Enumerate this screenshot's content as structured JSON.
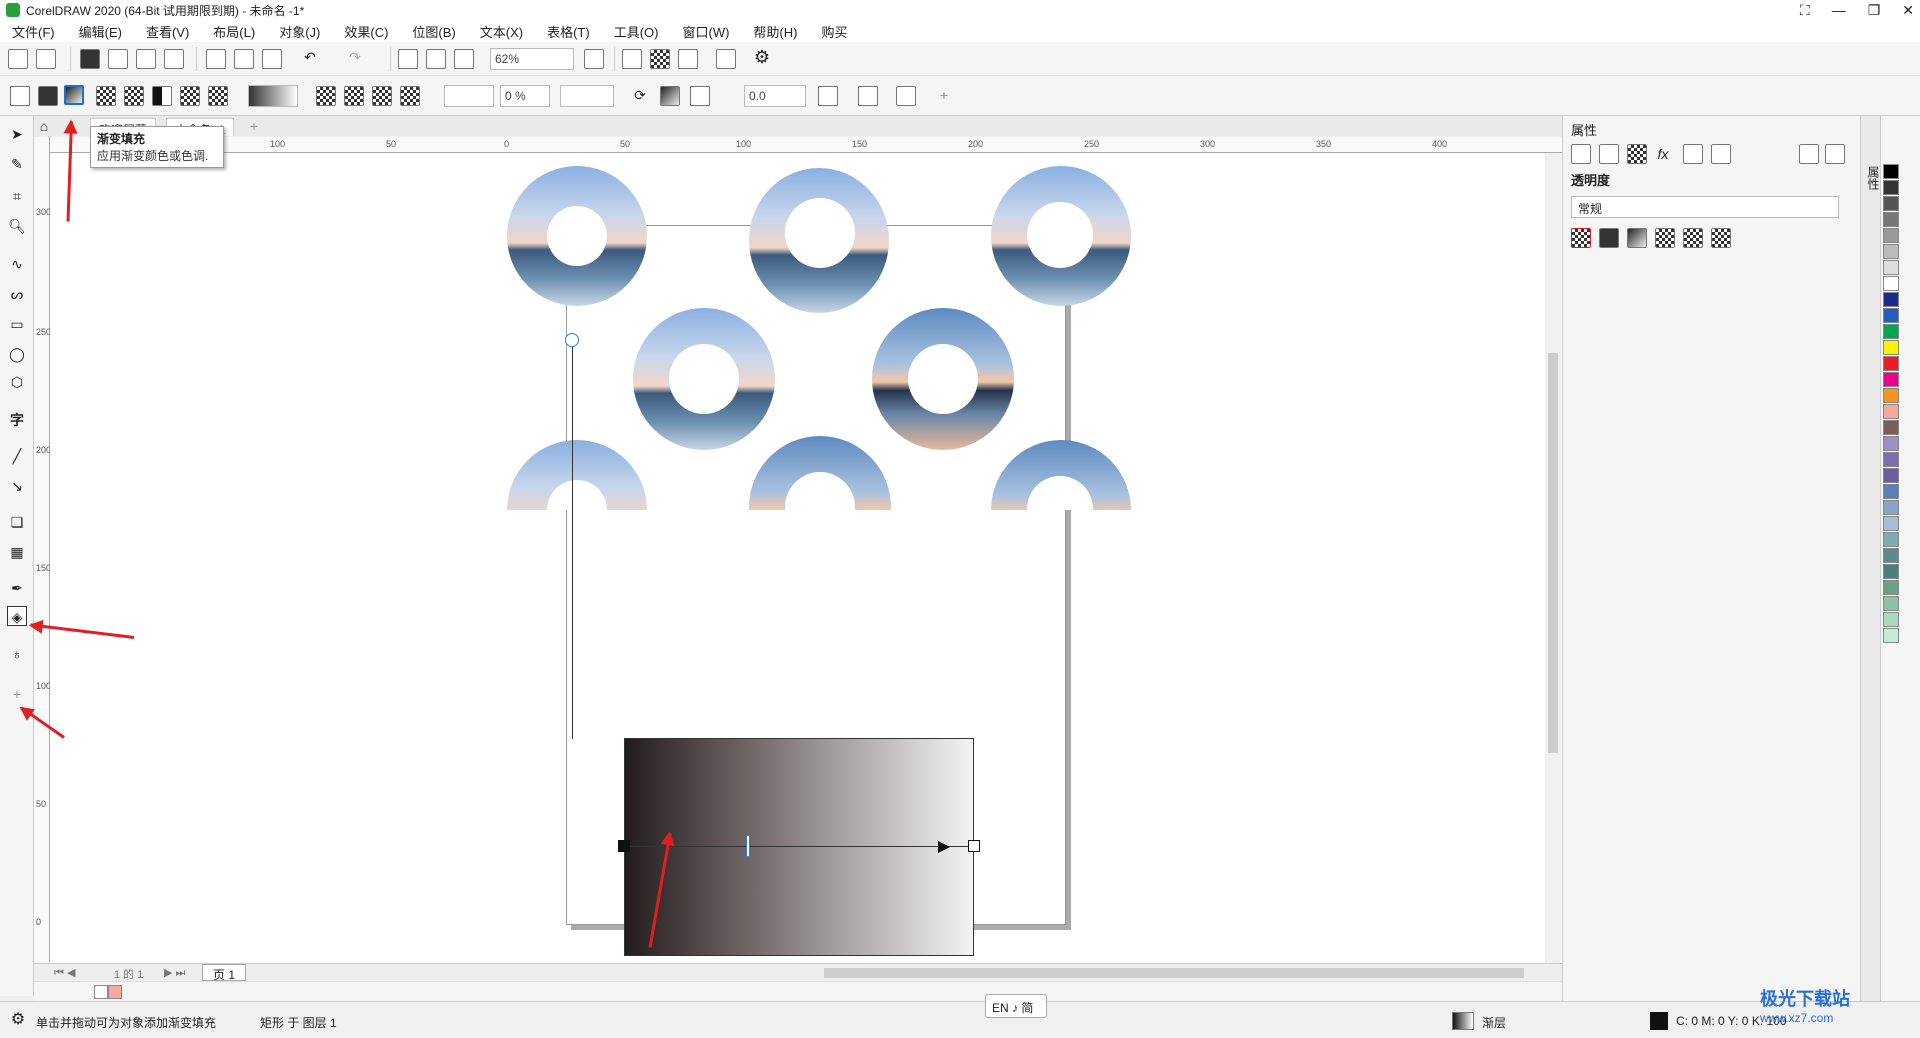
{
  "window": {
    "title": "CorelDRAW 2020 (64-Bit 试用期限到期) - 未命名 -1*"
  },
  "menu": [
    "文件(F)",
    "编辑(E)",
    "查看(V)",
    "布局(L)",
    "对象(J)",
    "效果(C)",
    "位图(B)",
    "文本(X)",
    "表格(T)",
    "工具(O)",
    "窗口(W)",
    "帮助(H)",
    "购买"
  ],
  "toolbar1": {
    "zoom": "62%"
  },
  "toolbar2": {
    "transparency": "0 %",
    "stroke_width": "0.0"
  },
  "tabs": {
    "welcome": "欢迎屏幕",
    "doc": "未命名 -1"
  },
  "tooltip": {
    "title": "渐变填充",
    "desc": "应用渐变颜色或色调."
  },
  "hruler_ticks": [
    "100",
    "50",
    "0",
    "50",
    "100",
    "150",
    "200",
    "250",
    "300",
    "350",
    "400"
  ],
  "vruler_ticks": [
    "300",
    "250",
    "200",
    "150",
    "100",
    "50",
    "0"
  ],
  "pager": {
    "page_info": "1 的 1",
    "page_tab": "页 1"
  },
  "properties": {
    "header": "属性",
    "section": "透明度",
    "mode": "常规",
    "side_tab": "属性"
  },
  "status": {
    "hint": "单击并拖动可为对象添加渐变填充",
    "object": "矩形 于 图层 1",
    "fill_label": "渐层",
    "cmyk": "C: 0 M: 0 Y: 0 K: 100",
    "ime": "EN ♪ 简"
  },
  "palette_colors": [
    "#000000",
    "#333333",
    "#555555",
    "#777777",
    "#999999",
    "#bbbbbb",
    "#dddddd",
    "#ffffff",
    "#1b2a8c",
    "#1e5fbf",
    "#00a651",
    "#fff200",
    "#ed1c24",
    "#ec008c",
    "#f7941d",
    "#f5a99a",
    "#7b5e57",
    "#9d8fc4",
    "#7b6fb0",
    "#6c5ea3",
    "#5d7fb5",
    "#8aa4c8",
    "#a6bdd8",
    "#7faab0",
    "#5a8c8c",
    "#4d7f7a",
    "#6aa08a",
    "#8cc0a8",
    "#a8d8c0",
    "#c8e8d8"
  ],
  "watermark": "极光下载站",
  "watermark_url": "www.xz7.com"
}
